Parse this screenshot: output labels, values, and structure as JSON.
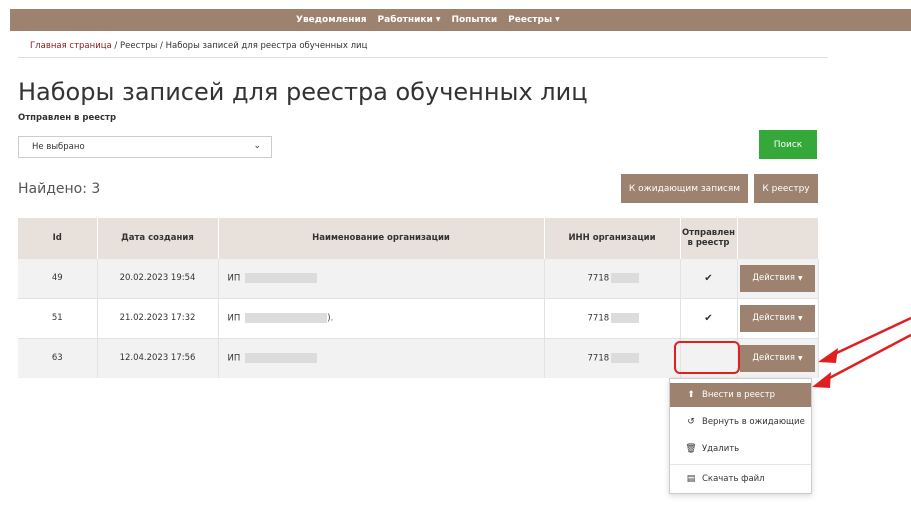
{
  "nav": {
    "items": [
      {
        "label": "Уведомления",
        "has_caret": false
      },
      {
        "label": "Работники",
        "has_caret": true
      },
      {
        "label": "Попытки",
        "has_caret": false
      },
      {
        "label": "Реестры",
        "has_caret": true
      }
    ]
  },
  "breadcrumb": {
    "home": "Главная страница",
    "separator": " / ",
    "registries": "Реестры",
    "current": "Наборы записей для реестра обученных лиц"
  },
  "page": {
    "title": "Наборы записей для реестра обученных лиц"
  },
  "filter": {
    "label": "Отправлен в реестр",
    "selected": "Не выбрано",
    "search_button": "Поиск"
  },
  "results": {
    "found_text": "Найдено: 3",
    "to_pending_button": "К ожидающим записям",
    "to_registry_button": "К реестру"
  },
  "table": {
    "headers": [
      "Id",
      "Дата создания",
      "Наименование организации",
      "ИНН организации",
      "Отправлен в реестр",
      ""
    ],
    "rows": [
      {
        "id": "49",
        "date": "20.02.2023 19:54",
        "org_prefix": "ИП",
        "org_suffix": "",
        "inn_prefix": "7718",
        "sent": true,
        "actions_label": "Действия"
      },
      {
        "id": "51",
        "date": "21.02.2023 17:32",
        "org_prefix": "ИП",
        "org_suffix": ").",
        "inn_prefix": "7718",
        "sent": true,
        "actions_label": "Действия"
      },
      {
        "id": "63",
        "date": "12.04.2023 17:56",
        "org_prefix": "ИП",
        "org_suffix": "",
        "inn_prefix": "7718",
        "sent": false,
        "actions_label": "Действия"
      }
    ]
  },
  "dropdown": {
    "items": [
      {
        "label": "Внести в реестр",
        "icon": "upload-icon",
        "active": true
      },
      {
        "label": "Вернуть в ожидающие",
        "icon": "undo-icon",
        "active": false
      },
      {
        "label": "Удалить",
        "icon": "trash-icon",
        "active": false
      },
      {
        "label": "Скачать файл",
        "icon": "file-icon",
        "active": false
      }
    ]
  },
  "colors": {
    "brand": "#9d8270",
    "success": "#35a83a",
    "annotation": "#e02020",
    "link": "#8b1a1a"
  }
}
